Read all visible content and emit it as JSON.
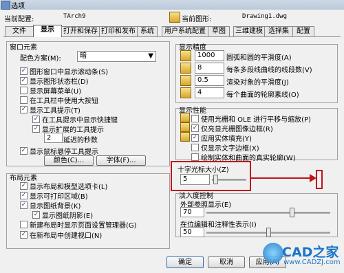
{
  "window": {
    "title": "选项"
  },
  "header": {
    "profile_label": "当前配置:",
    "profile_value": "TArch9",
    "drawing_label": "当前图形:",
    "drawing_value": "Drawing1.dwg"
  },
  "tabs": [
    "文件",
    "显示",
    "打开和保存",
    "打印和发布",
    "系统",
    "用户系统配置",
    "草图",
    "三维建模",
    "选择集",
    "配置"
  ],
  "window_elements": {
    "title": "窗口元素",
    "color_scheme_label": "配色方案(M):",
    "color_scheme_value": "暗",
    "checkboxes": [
      {
        "label": "图形窗口中显示滚动条(S)",
        "checked": true
      },
      {
        "label": "显示图形状态栏(D)",
        "checked": true
      },
      {
        "label": "显示屏幕菜单(U)",
        "checked": false
      },
      {
        "label": "在工具栏中使用大按钮",
        "checked": false
      },
      {
        "label": "显示工具提示(T)",
        "checked": true
      },
      {
        "label": "在工具提示中显示快捷键",
        "checked": true
      },
      {
        "label": "显示扩展的工具提示",
        "checked": true
      }
    ],
    "delay_value": "2",
    "delay_label": "延迟的秒数",
    "mouse_tooltip": {
      "label": "显示鼠标悬停工具提示",
      "checked": true
    },
    "colors_button": "颜色(C)...",
    "fonts_button": "字体(F)..."
  },
  "layout_elements": {
    "title": "布局元素",
    "checkboxes": [
      {
        "label": "显示布局和模型选项卡(L)",
        "checked": true
      },
      {
        "label": "显示可打印区域(B)",
        "checked": true
      },
      {
        "label": "显示图纸背景(K)",
        "checked": true
      },
      {
        "label": "显示图纸阴影(E)",
        "checked": true
      },
      {
        "label": "新建布局时显示页面设置管理器(G)",
        "checked": false
      },
      {
        "label": "在新布局中创建视口(N)",
        "checked": true
      }
    ]
  },
  "display_resolution": {
    "title": "显示精度",
    "rows": [
      {
        "value": "1000",
        "label": "圆弧和圆的平滑度(A)"
      },
      {
        "value": "8",
        "label": "每条多段线曲线的线段数(V)"
      },
      {
        "value": "0.5",
        "label": "渲染对象的平滑度(J)"
      },
      {
        "value": "4",
        "label": "每个曲面的轮廓素线(O)"
      }
    ]
  },
  "display_performance": {
    "title": "显示性能",
    "checkboxes": [
      {
        "label": "使用光栅和 OLE 进行平移与缩放(P)",
        "checked": false
      },
      {
        "label": "仅亮显光栅图像边框(R)",
        "checked": true
      },
      {
        "label": "应用实体填充(Y)",
        "checked": true
      },
      {
        "label": "仅显示文字边框(X)",
        "checked": false
      },
      {
        "label": "绘制实体和曲面的真实轮廓(W)",
        "checked": false
      }
    ]
  },
  "crosshair": {
    "title": "十字光标大小(Z)",
    "value": "5",
    "slider_fraction": 0.05
  },
  "fade_control": {
    "title": "淡入度控制",
    "xref_label": "外部参照显示(E)",
    "xref_value": "70",
    "xref_fraction": 0.7,
    "inplace_label": "在位编辑和注释性表示(I)",
    "inplace_value": "50",
    "inplace_fraction": 0.5
  },
  "buttons": {
    "ok": "确定",
    "cancel": "取消",
    "apply": "应用(A)"
  },
  "watermark": {
    "brand": "CAD之家",
    "url": "www.CADZJ.com"
  },
  "colors": {
    "accent_red": "#c0131c",
    "active_tab": "#ffffff"
  }
}
